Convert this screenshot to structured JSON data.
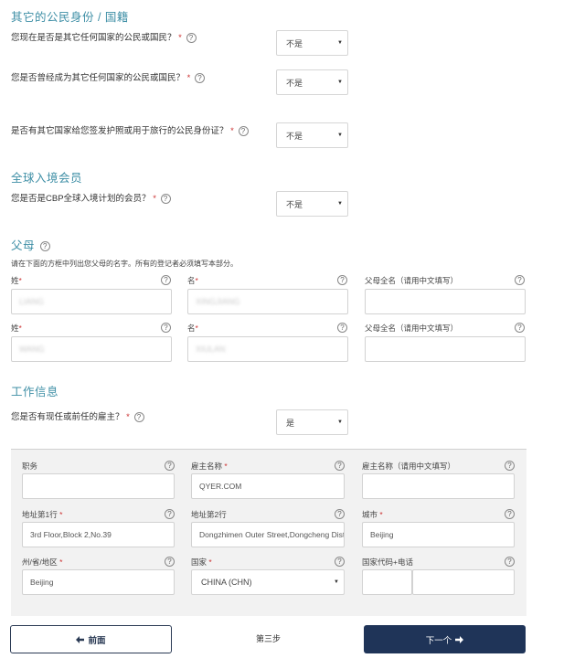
{
  "sections": {
    "citizenship": {
      "title": "其它的公民身份 / 国籍",
      "q1": {
        "label": "您现在是否是其它任何国家的公民或国民？",
        "value": "不是"
      },
      "q2": {
        "label": "您是否曾经成为其它任何国家的公民或国民？",
        "value": "不是"
      },
      "q3": {
        "label": "是否有其它国家给您签发护照或用于旅行的公民身份证？",
        "value": "不是"
      }
    },
    "global_entry": {
      "title": "全球入境会员",
      "q1": {
        "label": "您是否是CBP全球入境计划的会员？",
        "value": "不是"
      }
    },
    "parents": {
      "title": "父母",
      "note": "请在下面的方框中列出您父母的名字。所有的登记者必须填写本部分。",
      "surname_label": "姓",
      "given_label": "名",
      "fullname_label": "父母全名（请用中文填写）",
      "row1": {
        "surname": "LIANG",
        "given": "XINGJIANG",
        "fullname": ""
      },
      "row2": {
        "surname": "WANG",
        "given": "XIULAN",
        "fullname": ""
      }
    },
    "employment": {
      "title": "工作信息",
      "q1": {
        "label": "您是否有现任或前任的雇主？",
        "value": "是"
      },
      "job_title_label": "职务",
      "job_title": "",
      "employer_label": "雇主名称",
      "employer": "QYER.COM",
      "employer_cn_label": "雇主名称（请用中文填写）",
      "employer_cn": "",
      "addr1_label": "地址第1行",
      "addr1": "3rd Floor,Block 2,No.39",
      "addr2_label": "地址第2行",
      "addr2": "Dongzhimen Outer Street,Dongcheng Distr",
      "city_label": "城市",
      "city": "Beijing",
      "state_label": "州/省/地区",
      "state": "Beijing",
      "country_label": "国家",
      "country": "CHINA (CHN)",
      "phone_label": "国家代码+电话",
      "phone_code": "",
      "phone": ""
    }
  },
  "nav": {
    "prev_label": "前面",
    "step_label": "第三步",
    "next_label": "下一个"
  },
  "required_mark": "*",
  "help_glyph": "?",
  "caret_glyph": "▼",
  "colors": {
    "section_title": "#3f8fa6",
    "primary_button": "#1f3458",
    "required": "#cc3333"
  }
}
